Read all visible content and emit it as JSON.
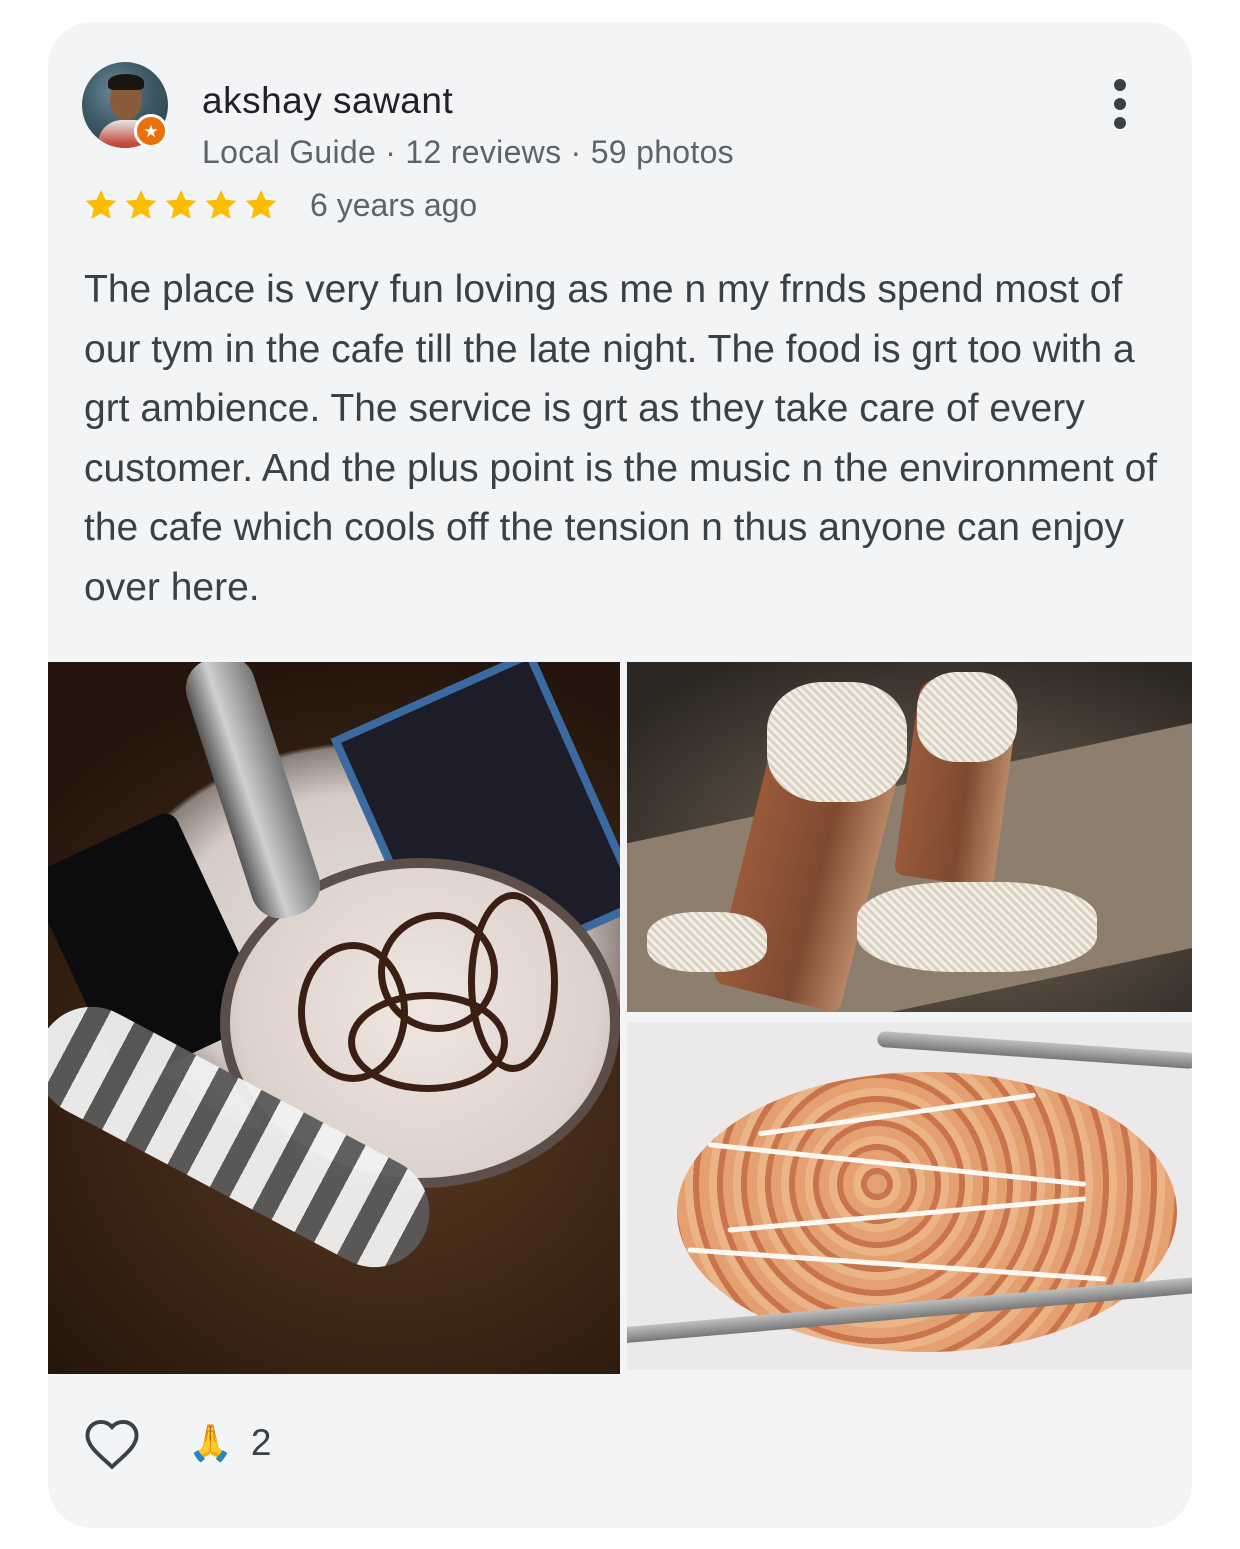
{
  "reviewer": {
    "name": "akshay sawant",
    "meta": "Local Guide · 12 reviews · 59 photos",
    "badge_icon": "local-guide-star-badge"
  },
  "rating": {
    "stars": 5,
    "max": 5,
    "star_color": "#fbbc04",
    "time_ago": "6 years ago"
  },
  "review": {
    "text": "The place is very fun loving as me n my frnds spend most of our tym in the cafe till the late night. The food is grt too with a grt ambience. The service is grt as they take care of every customer. And the plus point is the music n the environment of the cafe which cools off the tension n thus anyone can enjoy over here."
  },
  "photos": [
    {
      "subject": "milkshake with chocolate drizzle"
    },
    {
      "subject": "cheese toast sandwich"
    },
    {
      "subject": "pasta with mayo"
    }
  ],
  "actions": {
    "like_icon": "heart-outline-icon",
    "reaction_emoji": "🙏",
    "reaction_count": "2"
  },
  "theme": {
    "card_background": "#f3f4f6",
    "badge_color": "#e8710a"
  }
}
